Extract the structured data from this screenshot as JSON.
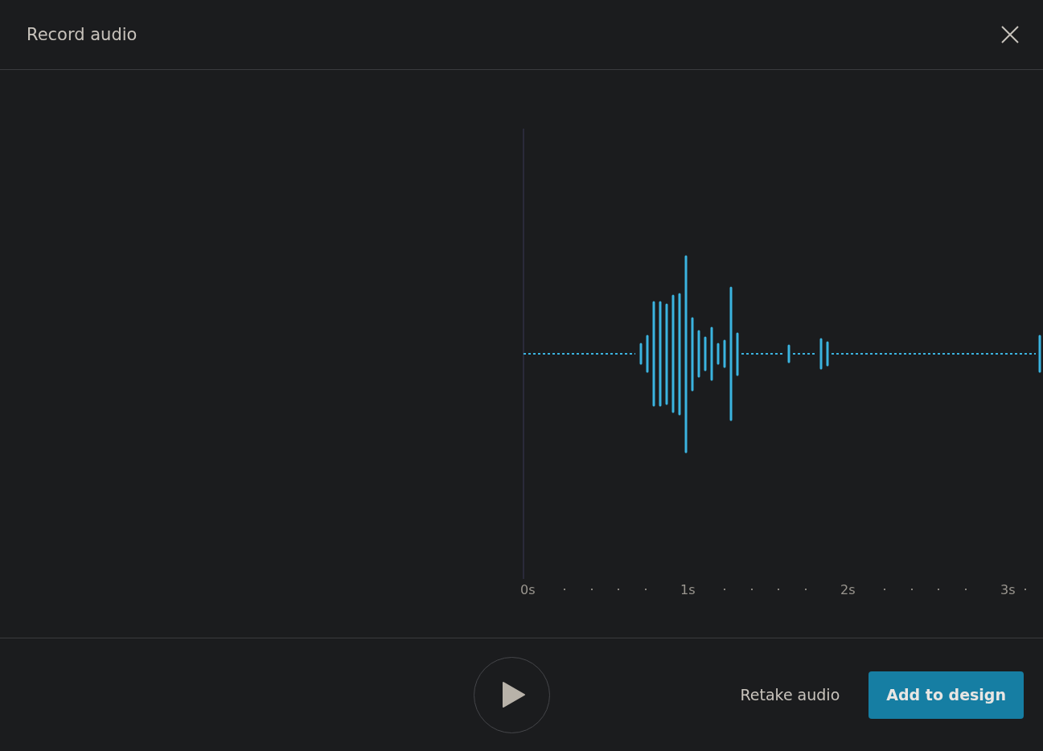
{
  "dialog": {
    "title": "Record audio"
  },
  "timeline": {
    "labels": [
      "0s",
      "1s",
      "2s",
      "3s"
    ]
  },
  "footer": {
    "retake_label": "Retake audio",
    "add_label": "Add to design"
  }
}
